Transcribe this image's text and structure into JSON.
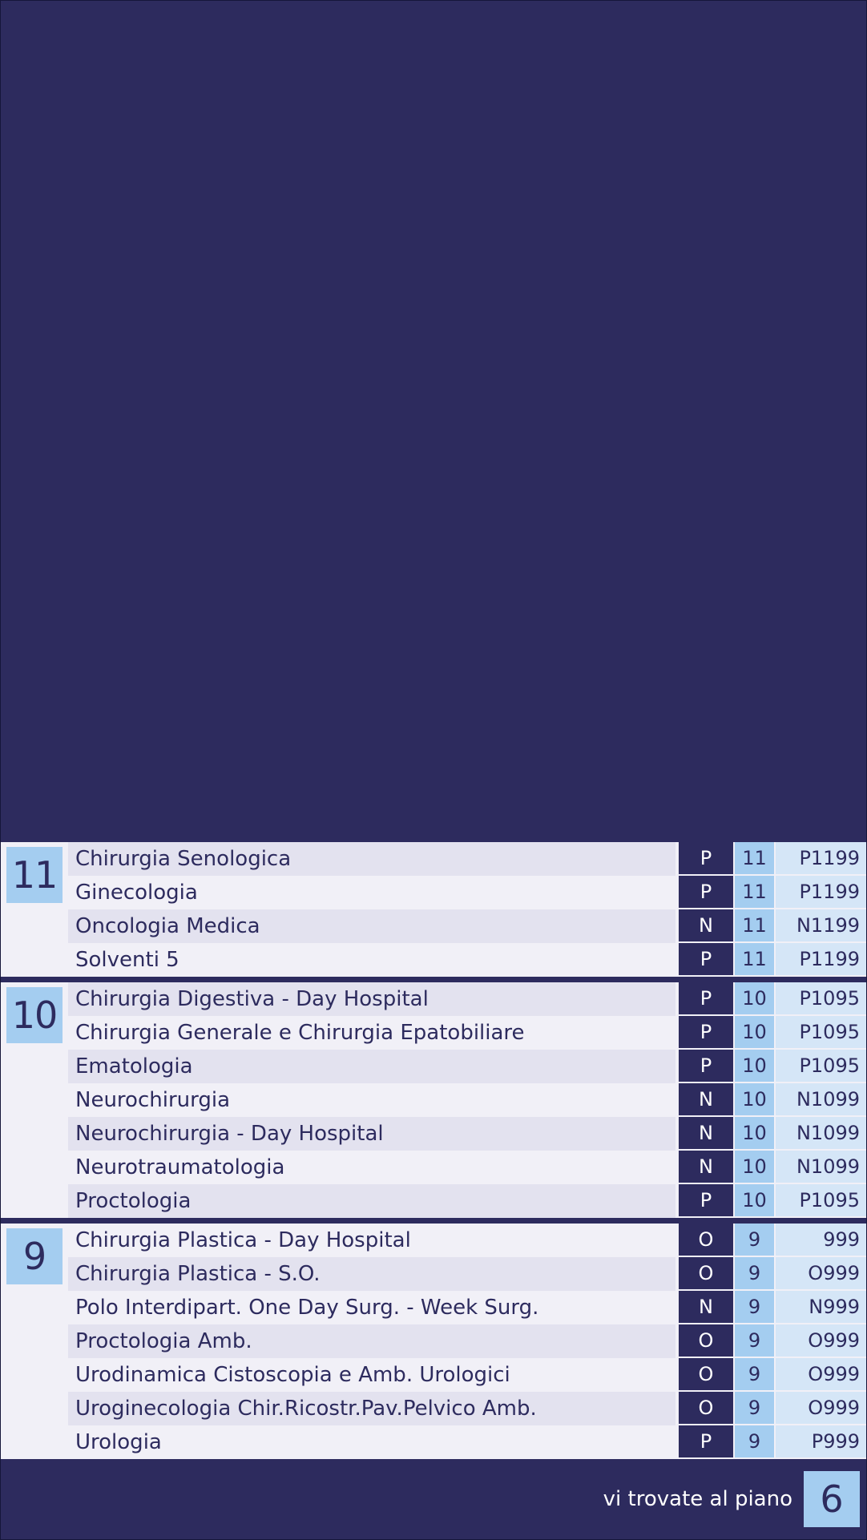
{
  "colors": {
    "background": "#2d2b5e",
    "badge": "#a4cdf0",
    "code_cell": "#d5e6f7",
    "row_light": "#f1f0f7",
    "row_dark": "#e3e2ef"
  },
  "floors": [
    {
      "number": "11",
      "departments": [
        {
          "name": "Chirurgia Senologica",
          "tower": "P",
          "floor": "11",
          "code": "P1199"
        },
        {
          "name": "Ginecologia",
          "tower": "P",
          "floor": "11",
          "code": "P1199"
        },
        {
          "name": "Oncologia Medica",
          "tower": "N",
          "floor": "11",
          "code": "N1199"
        },
        {
          "name": "Solventi 5",
          "tower": "P",
          "floor": "11",
          "code": "P1199"
        }
      ]
    },
    {
      "number": "10",
      "departments": [
        {
          "name": "Chirurgia Digestiva - Day Hospital",
          "tower": "P",
          "floor": "10",
          "code": "P1095"
        },
        {
          "name": "Chirurgia Generale e Chirurgia Epatobiliare",
          "tower": "P",
          "floor": "10",
          "code": "P1095"
        },
        {
          "name": "Ematologia",
          "tower": "P",
          "floor": "10",
          "code": "P1095"
        },
        {
          "name": "Neurochirurgia",
          "tower": "N",
          "floor": "10",
          "code": "N1099"
        },
        {
          "name": "Neurochirurgia - Day Hospital",
          "tower": "N",
          "floor": "10",
          "code": "N1099"
        },
        {
          "name": "Neurotraumatologia",
          "tower": "N",
          "floor": "10",
          "code": "N1099"
        },
        {
          "name": "Proctologia",
          "tower": "P",
          "floor": "10",
          "code": "P1095"
        }
      ]
    },
    {
      "number": "9",
      "departments": [
        {
          "name": "Chirurgia Plastica - Day Hospital",
          "tower": "O",
          "floor": "9",
          "code": "999"
        },
        {
          "name": "Chirurgia Plastica - S.O.",
          "tower": "O",
          "floor": "9",
          "code": "O999"
        },
        {
          "name": "Polo Interdipart. One Day Surg. - Week Surg.",
          "tower": "N",
          "floor": "9",
          "code": "N999"
        },
        {
          "name": "Proctologia Amb.",
          "tower": "O",
          "floor": "9",
          "code": "O999"
        },
        {
          "name": "Urodinamica Cistoscopia e Amb. Urologici",
          "tower": "O",
          "floor": "9",
          "code": "O999"
        },
        {
          "name": "Uroginecologia Chir.Ricostr.Pav.Pelvico Amb.",
          "tower": "O",
          "floor": "9",
          "code": "O999"
        },
        {
          "name": "Urologia",
          "tower": "P",
          "floor": "9",
          "code": "P999"
        }
      ]
    }
  ],
  "footer": {
    "label": "vi trovate al piano",
    "current_floor": "6"
  }
}
